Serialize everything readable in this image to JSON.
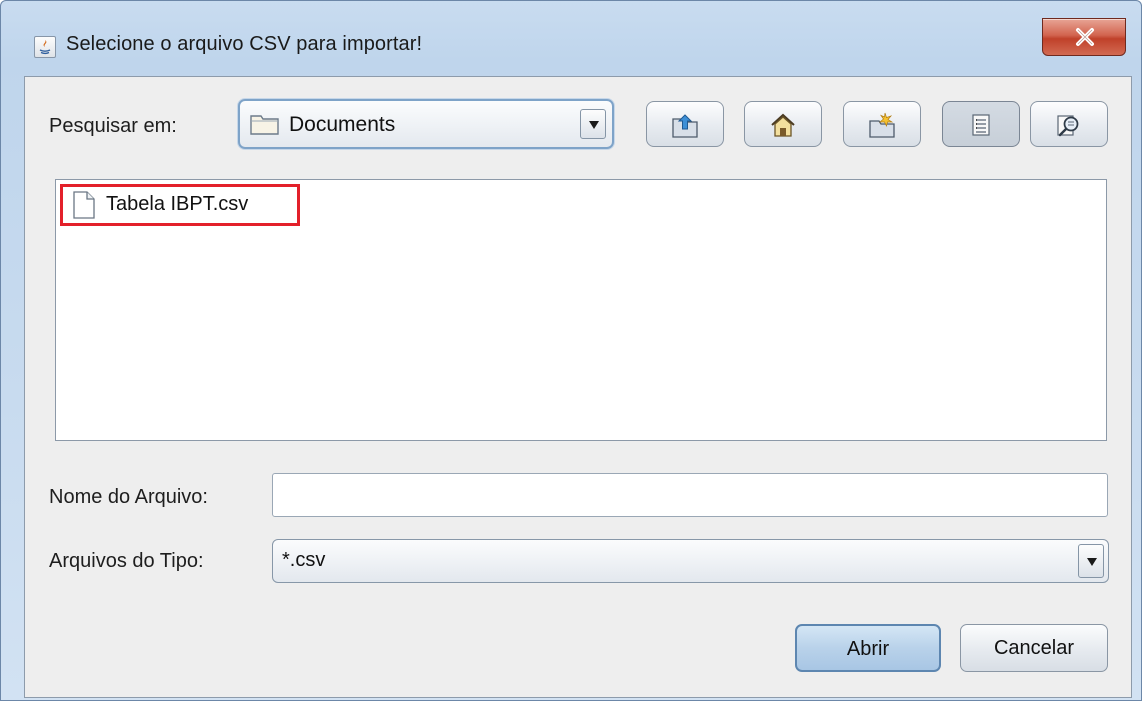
{
  "window": {
    "title": "Selecione o arquivo CSV para importar!"
  },
  "toolbar": {
    "look_in_label": "Pesquisar em:",
    "look_in_value": "Documents",
    "buttons": [
      {
        "name": "up-one-level",
        "icon": "folder-up-icon"
      },
      {
        "name": "home",
        "icon": "home-icon"
      },
      {
        "name": "new-folder",
        "icon": "new-folder-icon"
      },
      {
        "name": "list-view",
        "icon": "list-view-icon",
        "pressed": true
      },
      {
        "name": "details-view",
        "icon": "details-view-icon",
        "pressed": false
      }
    ]
  },
  "file_list": {
    "items": [
      {
        "name": "Tabela IBPT.csv",
        "icon": "file-icon",
        "highlighted": true,
        "highlight_color": "#e3202a"
      }
    ]
  },
  "form": {
    "file_name_label": "Nome do Arquivo:",
    "file_name_value": "",
    "file_type_label": "Arquivos do Tipo:",
    "file_type_value": "*.csv"
  },
  "buttons": {
    "open_label": "Abrir",
    "cancel_label": "Cancelar"
  },
  "colors": {
    "close_button": "#c0412a",
    "highlight": "#e3202a",
    "accent": "#7ea3c8"
  }
}
